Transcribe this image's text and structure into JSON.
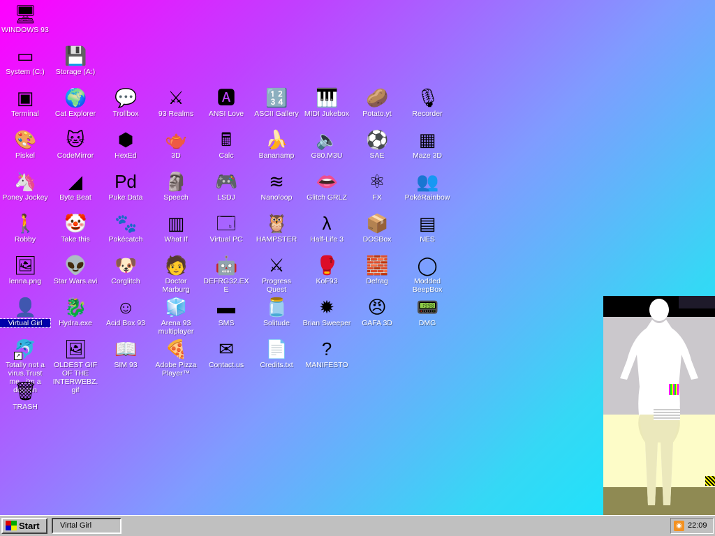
{
  "desktop": {
    "background_colors": [
      "#ff00ff",
      "#10eaff"
    ],
    "icons": [
      {
        "label": "WINDOWS 93",
        "icon": "computer-icon",
        "glyph": "🖥"
      },
      {
        "label": "System (C:)",
        "icon": "hard-drive-icon",
        "glyph": "▭"
      },
      {
        "label": "Storage (A:)",
        "icon": "floppy-drive-icon",
        "glyph": "💾"
      },
      {
        "label": "Terminal",
        "icon": "terminal-icon",
        "glyph": "▣"
      },
      {
        "label": "Cat Explorer",
        "icon": "globe-cat-icon",
        "glyph": "🌍"
      },
      {
        "label": "Trollbox",
        "icon": "chat-bubble-icon",
        "glyph": "💬"
      },
      {
        "label": "93 Realms",
        "icon": "red-knight-icon",
        "glyph": "⚔"
      },
      {
        "label": "ANSI Love",
        "icon": "letter-a-icon",
        "glyph": "🅰"
      },
      {
        "label": "ASCII Gallery",
        "icon": "numbers-icon",
        "glyph": "🔢"
      },
      {
        "label": "MIDI Jukebox",
        "icon": "piano-keys-icon",
        "glyph": "🎹"
      },
      {
        "label": "Potato.yt",
        "icon": "potato-icon",
        "glyph": "🥔"
      },
      {
        "label": "Recorder",
        "icon": "microphone-icon",
        "glyph": "🎙"
      },
      {
        "label": "Piskel",
        "icon": "palette-icon",
        "glyph": "🎨"
      },
      {
        "label": "CodeMirror",
        "icon": "cat-mirror-icon",
        "glyph": "🐱"
      },
      {
        "label": "HexEd",
        "icon": "cube-icon",
        "glyph": "⬢"
      },
      {
        "label": "3D",
        "icon": "teapot-icon",
        "glyph": "🫖"
      },
      {
        "label": "Calc",
        "icon": "calculator-icon",
        "glyph": "🖩"
      },
      {
        "label": "Bananamp",
        "icon": "banana-icon",
        "glyph": "🍌"
      },
      {
        "label": "G80.M3U",
        "icon": "speaker-file-icon",
        "glyph": "🔈"
      },
      {
        "label": "SAE",
        "icon": "checkered-ball-icon",
        "glyph": "⚽"
      },
      {
        "label": "Maze 3D",
        "icon": "maze-icon",
        "glyph": "▦"
      },
      {
        "label": "Poney Jockey",
        "icon": "pony-icon",
        "glyph": "🦄"
      },
      {
        "label": "Byte Beat",
        "icon": "green-wave-icon",
        "glyph": "◢"
      },
      {
        "label": "Puke Data",
        "icon": "pd-icon",
        "glyph": "Pd"
      },
      {
        "label": "Speech",
        "icon": "face-icon",
        "glyph": "🗿"
      },
      {
        "label": "LSDJ",
        "icon": "gameboy-icon",
        "glyph": "🎮"
      },
      {
        "label": "Nanoloop",
        "icon": "wave-lines-icon",
        "glyph": "≋"
      },
      {
        "label": "Glitch GRLZ",
        "icon": "lips-icon",
        "glyph": "👄"
      },
      {
        "label": "FX",
        "icon": "atom-icon",
        "glyph": "⚛"
      },
      {
        "label": "PokéRainbow",
        "icon": "pokemon-trainers-icon",
        "glyph": "👥"
      },
      {
        "label": "Robby",
        "icon": "stick-figure-icon",
        "glyph": "🚶"
      },
      {
        "label": "Take this",
        "icon": "clown-icon",
        "glyph": "🤡"
      },
      {
        "label": "Pokécatch",
        "icon": "pokeball-icon",
        "glyph": "🐾"
      },
      {
        "label": "What If",
        "icon": "green-bars-icon",
        "glyph": "▥"
      },
      {
        "label": "Virtual PC",
        "icon": "window-icon",
        "glyph": "🗔"
      },
      {
        "label": "HAMPSTER",
        "icon": "owl-icon",
        "glyph": "🦉"
      },
      {
        "label": "Half-Life 3",
        "icon": "lambda-icon",
        "glyph": "λ"
      },
      {
        "label": "DOSBox",
        "icon": "dosbox-icon",
        "glyph": "📦"
      },
      {
        "label": "NES",
        "icon": "nes-console-icon",
        "glyph": "▤"
      },
      {
        "label": "lenna.png",
        "icon": "image-file-icon",
        "glyph": "🖼"
      },
      {
        "label": "Star Wars.avi",
        "icon": "yoda-icon",
        "glyph": "👽"
      },
      {
        "label": "Corglitch",
        "icon": "corgi-icon",
        "glyph": "🐶"
      },
      {
        "label": "Doctor Marburg",
        "icon": "doctor-icon",
        "glyph": "🧑"
      },
      {
        "label": "DEFRG32.EXE",
        "icon": "robot-face-icon",
        "glyph": "🤖"
      },
      {
        "label": "Progress Quest",
        "icon": "crossed-swords-icon",
        "glyph": "⚔"
      },
      {
        "label": "KoF93",
        "icon": "fighter-icon",
        "glyph": "🥊"
      },
      {
        "label": "Defrag",
        "icon": "defrag-blocks-icon",
        "glyph": "🧱"
      },
      {
        "label": "Modded BeepBox",
        "icon": "green-ring-icon",
        "glyph": "◯"
      },
      {
        "label": "Virtual Girl",
        "icon": "blue-face-icon",
        "glyph": "👤"
      },
      {
        "label": "Hydra.exe",
        "icon": "dragon-icon",
        "glyph": "🐉"
      },
      {
        "label": "Acid Box 93",
        "icon": "smiley-icon",
        "glyph": "☺"
      },
      {
        "label": "Arena 93 multiplayer",
        "icon": "color-cube-icon",
        "glyph": "🧊"
      },
      {
        "label": "SMS",
        "icon": "master-system-icon",
        "glyph": "▬"
      },
      {
        "label": "Solitude",
        "icon": "jar-icon",
        "glyph": "🫙"
      },
      {
        "label": "Brian Sweeper",
        "icon": "mine-icon",
        "glyph": "✹"
      },
      {
        "label": "GAFA 3D",
        "icon": "doomguy-icon",
        "glyph": "😠"
      },
      {
        "label": "DMG",
        "icon": "dmg-icon",
        "glyph": "📟"
      },
      {
        "label": "Totally not a virus.Trust me...i'm a dolphin",
        "icon": "dolphin-icon",
        "glyph": "🐬"
      },
      {
        "label": "OLDEST GIF OF THE INTERWEBZ.gif",
        "icon": "gif-file-icon",
        "glyph": "🖼"
      },
      {
        "label": "SIM 93",
        "icon": "book-icon",
        "glyph": "📖"
      },
      {
        "label": "Adobe Pizza Player™",
        "icon": "pizza-icon",
        "glyph": "🍕"
      },
      {
        "label": "Contact.us",
        "icon": "mail-icon",
        "glyph": "✉"
      },
      {
        "label": "Credits.txt",
        "icon": "text-file-icon",
        "glyph": "📄"
      },
      {
        "label": "MANIFESTO",
        "icon": "question-mark-icon",
        "glyph": "?"
      },
      {
        "label": "TRASH",
        "icon": "recycle-bin-icon",
        "glyph": "🗑"
      }
    ]
  },
  "taskbar": {
    "start_label": "Start",
    "tasks": [
      {
        "label": "Virtal Girl"
      }
    ],
    "tray": {
      "icon": "rss-icon",
      "clock": "22:09"
    }
  }
}
